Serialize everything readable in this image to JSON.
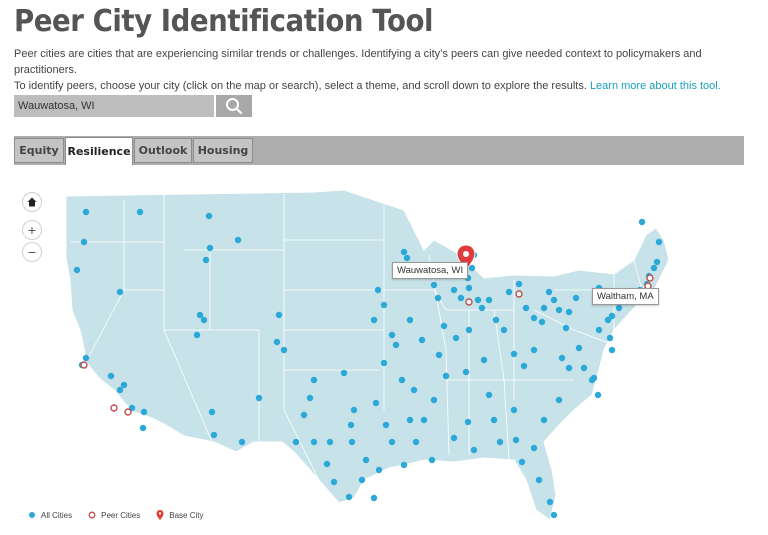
{
  "header": {
    "title": "Peer City Identification Tool",
    "intro_line1": "Peer cities are cities that are experiencing similar trends or challenges. Identifying a city’s peers can give needed context to policymakers and practitioners.",
    "intro_line2": "To identify peers, choose your city (click on the map or search), select a theme, and scroll down to explore the results. ",
    "learn_more": "Learn more about this tool."
  },
  "search": {
    "value": "Wauwatosa, WI",
    "icon": "search-icon"
  },
  "tabs": [
    {
      "label": "Equity",
      "active": false
    },
    {
      "label": "Resilience",
      "active": true
    },
    {
      "label": "Outlook",
      "active": false
    },
    {
      "label": "Housing",
      "active": false
    }
  ],
  "map": {
    "controls": {
      "home": "home-icon",
      "zoom_in": "+",
      "zoom_out": "−"
    },
    "base_city_label": "Wauwatosa, WI",
    "peer_label": "Waltham, MA",
    "colors": {
      "land": "#c7e2e8",
      "border": "#ffffff",
      "all_city": "#2aa8d8",
      "peer": "#c0504d",
      "base": "#e03c3c"
    }
  },
  "legend": {
    "all_cities": "All Cities",
    "peer_cities": "Peer Cities",
    "base_city": "Base City"
  }
}
